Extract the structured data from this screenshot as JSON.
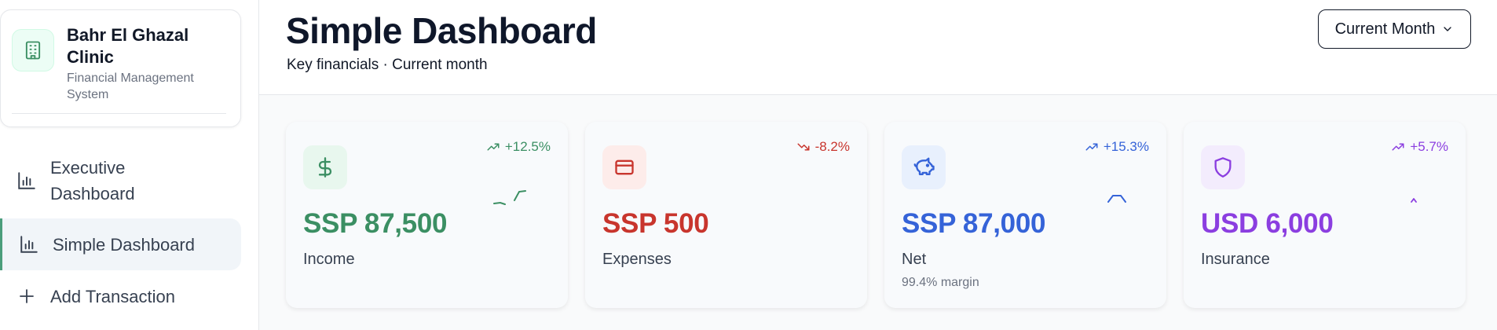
{
  "sidebar": {
    "brand": {
      "name": "Bahr El Ghazal Clinic",
      "subtitle": "Financial Management System",
      "icon": "building-icon"
    },
    "items": [
      {
        "label": "Executive Dashboard",
        "icon": "bar-chart-icon",
        "active": false
      },
      {
        "label": "Simple Dashboard",
        "icon": "bar-chart-icon",
        "active": true
      },
      {
        "label": "Add Transaction",
        "icon": "plus-icon",
        "active": false
      }
    ]
  },
  "header": {
    "title": "Simple Dashboard",
    "subtitle": "Key financials · Current month",
    "period_select": {
      "value": "Current Month",
      "icon": "chevron-down-icon"
    }
  },
  "cards": [
    {
      "label": "Income",
      "value": "SSP 87,500",
      "trend": "+12.5%",
      "trend_direction": "up",
      "icon": "dollar-icon",
      "color": "#3b8f63",
      "icon_bg": "#e8f7ee"
    },
    {
      "label": "Expenses",
      "value": "SSP 500",
      "trend": "-8.2%",
      "trend_direction": "down",
      "icon": "credit-card-icon",
      "color": "#c8352d",
      "icon_bg": "#fdecea"
    },
    {
      "label": "Net",
      "value": "SSP 87,000",
      "trend": "+15.3%",
      "trend_direction": "up",
      "icon": "piggy-bank-icon",
      "color": "#3563d8",
      "icon_bg": "#e8f0fd",
      "note": "99.4% margin"
    },
    {
      "label": "Insurance",
      "value": "USD 6,000",
      "trend": "+5.7%",
      "trend_direction": "up",
      "icon": "shield-icon",
      "color": "#8b3ee0",
      "icon_bg": "#f3ecfd"
    }
  ]
}
